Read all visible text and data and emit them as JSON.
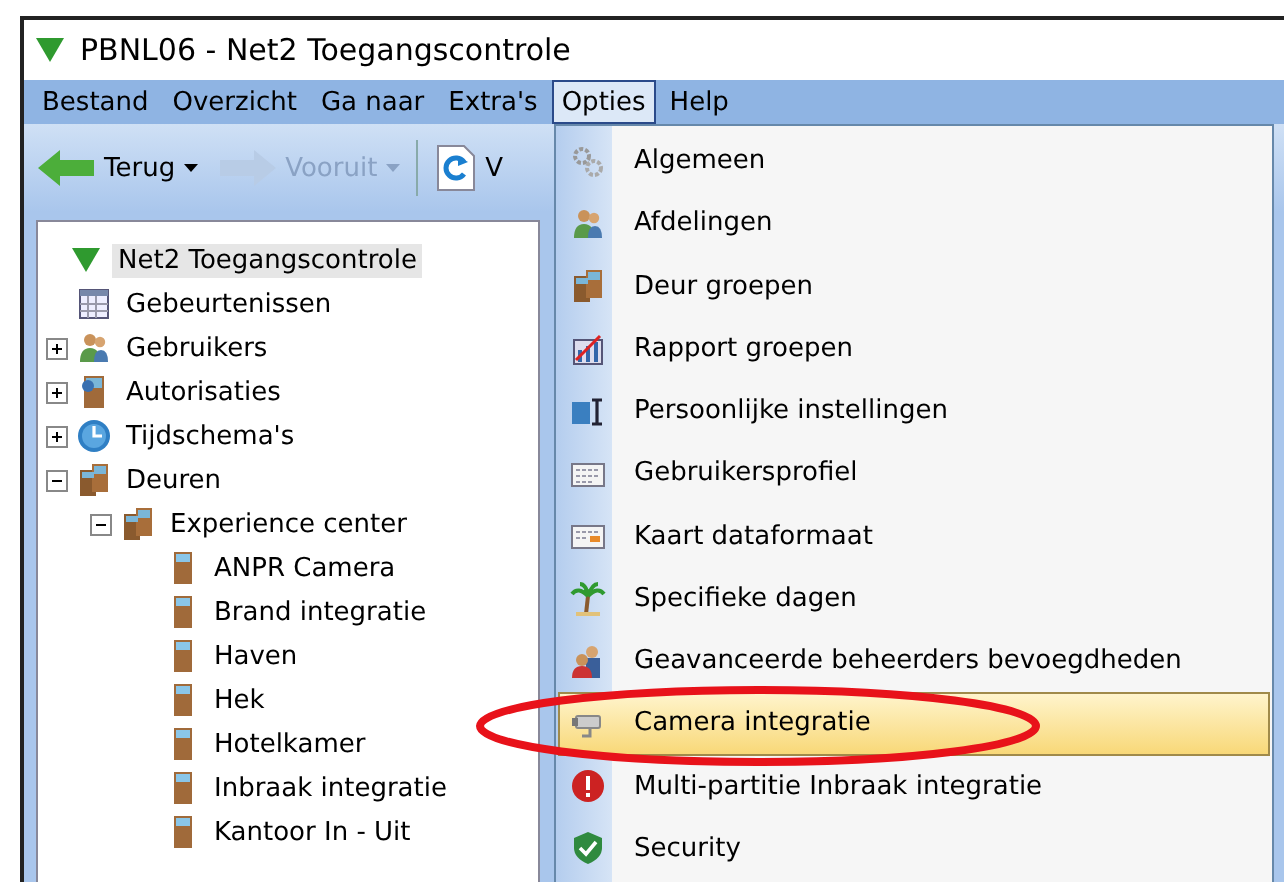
{
  "window": {
    "title": "PBNL06 - Net2 Toegangscontrole"
  },
  "menubar": [
    {
      "label": "Bestand",
      "selected": false
    },
    {
      "label": "Overzicht",
      "selected": false
    },
    {
      "label": "Ga naar",
      "selected": false
    },
    {
      "label": "Extra's",
      "selected": false
    },
    {
      "label": "Opties",
      "selected": true
    },
    {
      "label": "Help",
      "selected": false
    }
  ],
  "toolbar": [
    {
      "kind": "back",
      "label": "Terug",
      "disabled": false
    },
    {
      "kind": "forward",
      "label": "Vooruit",
      "disabled": true
    },
    {
      "kind": "refresh",
      "label": "V",
      "disabled": false
    }
  ],
  "tree": [
    {
      "label": "Net2 Toegangscontrole",
      "kind": "root",
      "selected": true,
      "children": [
        {
          "label": "Gebeurtenissen",
          "kind": "events",
          "selected": false
        },
        {
          "label": "Gebruikers",
          "kind": "users",
          "expanded": false,
          "selected": false
        },
        {
          "label": "Autorisaties",
          "kind": "access",
          "expanded": false,
          "selected": false
        },
        {
          "label": "Tijdschema's",
          "kind": "schedule",
          "expanded": false,
          "selected": false
        },
        {
          "label": "Deuren",
          "kind": "doors",
          "expanded": true,
          "selected": false,
          "children": [
            {
              "label": "Experience center",
              "kind": "doors",
              "expanded": true,
              "selected": false,
              "children": [
                {
                  "label": "ANPR Camera",
                  "kind": "door",
                  "selected": false
                },
                {
                  "label": "Brand integratie",
                  "kind": "door",
                  "selected": false
                },
                {
                  "label": "Haven",
                  "kind": "door",
                  "selected": false
                },
                {
                  "label": "Hek",
                  "kind": "door",
                  "selected": false
                },
                {
                  "label": "Hotelkamer",
                  "kind": "door",
                  "selected": false
                },
                {
                  "label": "Inbraak integratie",
                  "kind": "door",
                  "selected": false
                },
                {
                  "label": "Kantoor In - Uit",
                  "kind": "door",
                  "selected": false
                }
              ]
            }
          ]
        }
      ]
    }
  ],
  "menu": [
    {
      "label": "Algemeen",
      "kind": "general",
      "selected": false
    },
    {
      "label": "Afdelingen",
      "kind": "departments",
      "selected": false
    },
    {
      "label": "Deur groepen",
      "kind": "doors",
      "selected": false
    },
    {
      "label": "Rapport groepen",
      "kind": "reports",
      "selected": false
    },
    {
      "label": "Persoonlijke instellingen",
      "kind": "personal",
      "selected": false
    },
    {
      "label": "Gebruikersprofiel",
      "kind": "profile",
      "selected": false
    },
    {
      "label": "Kaart dataformaat",
      "kind": "cardformat",
      "selected": false
    },
    {
      "label": "Specifieke dagen",
      "kind": "days",
      "selected": false
    },
    {
      "label": "Geavanceerde beheerders bevoegdheden",
      "kind": "admins",
      "selected": false
    },
    {
      "label": "Camera integratie",
      "kind": "camera",
      "selected": true
    },
    {
      "label": "Multi-partitie Inbraak integratie",
      "kind": "alarm",
      "selected": false
    },
    {
      "label": "Security",
      "kind": "security",
      "selected": false
    }
  ]
}
